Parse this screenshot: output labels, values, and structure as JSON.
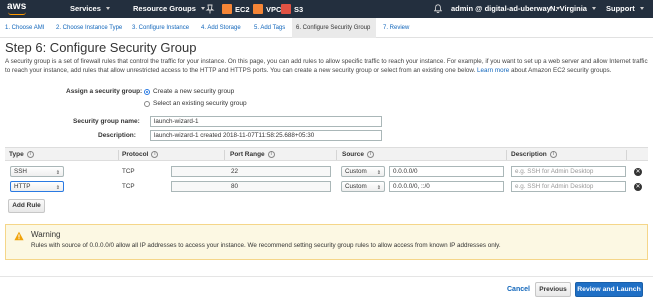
{
  "topnav": {
    "logo": "aws",
    "services": "Services",
    "resource_groups": "Resource Groups",
    "ec2": "EC2",
    "vpc": "VPC",
    "s3": "S3",
    "account": "admin @ digital-ad-uberway",
    "region": "N. Virginia",
    "support": "Support"
  },
  "tabs": [
    {
      "label": "1. Choose AMI"
    },
    {
      "label": "2. Choose Instance Type"
    },
    {
      "label": "3. Configure Instance"
    },
    {
      "label": "4. Add Storage"
    },
    {
      "label": "5. Add Tags"
    },
    {
      "label": "6. Configure Security Group"
    },
    {
      "label": "7. Review"
    }
  ],
  "page": {
    "title": "Step 6: Configure Security Group",
    "description": "A security group is a set of firewall rules that control the traffic for your instance. On this page, you can add rules to allow specific traffic to reach your instance. For example, if you want to set up a web server and allow Internet traffic to reach your instance, add rules that allow unrestricted access to the HTTP and HTTPS ports. You can create a new security group or select from an existing one below.",
    "learn_more": "Learn more",
    "description_tail": "about Amazon EC2 security groups."
  },
  "form": {
    "assign_label": "Assign a security group:",
    "option_new": "Create a new security group",
    "option_existing": "Select an existing security group",
    "name_label": "Security group name:",
    "name_value": "launch-wizard-1",
    "desc_label": "Description:",
    "desc_value": "launch-wizard-1 created 2018-11-07T11:58:25.688+05:30"
  },
  "table": {
    "headers": {
      "type": "Type",
      "protocol": "Protocol",
      "port_range": "Port Range",
      "source": "Source",
      "description": "Description"
    },
    "rows": [
      {
        "type": "SSH",
        "protocol": "TCP",
        "port": "22",
        "source_mode": "Custom",
        "source": "0.0.0.0/0",
        "description_placeholder": "e.g. SSH for Admin Desktop"
      },
      {
        "type": "HTTP",
        "protocol": "TCP",
        "port": "80",
        "source_mode": "Custom",
        "source": "0.0.0.0/0, ::/0",
        "description_placeholder": "e.g. SSH for Admin Desktop"
      }
    ],
    "add_rule": "Add Rule"
  },
  "warning": {
    "title": "Warning",
    "text": "Rules with source of 0.0.0.0/0 allow all IP addresses to access your instance. We recommend setting security group rules to allow access from known IP addresses only."
  },
  "footer": {
    "cancel": "Cancel",
    "previous": "Previous",
    "review_launch": "Review and Launch"
  },
  "colors": {
    "nav_bg": "#232f3e",
    "link": "#1166bb",
    "primary": "#1f6fc5",
    "warning_bg": "#fcf8e3",
    "warning_accent": "#f0a30a"
  }
}
